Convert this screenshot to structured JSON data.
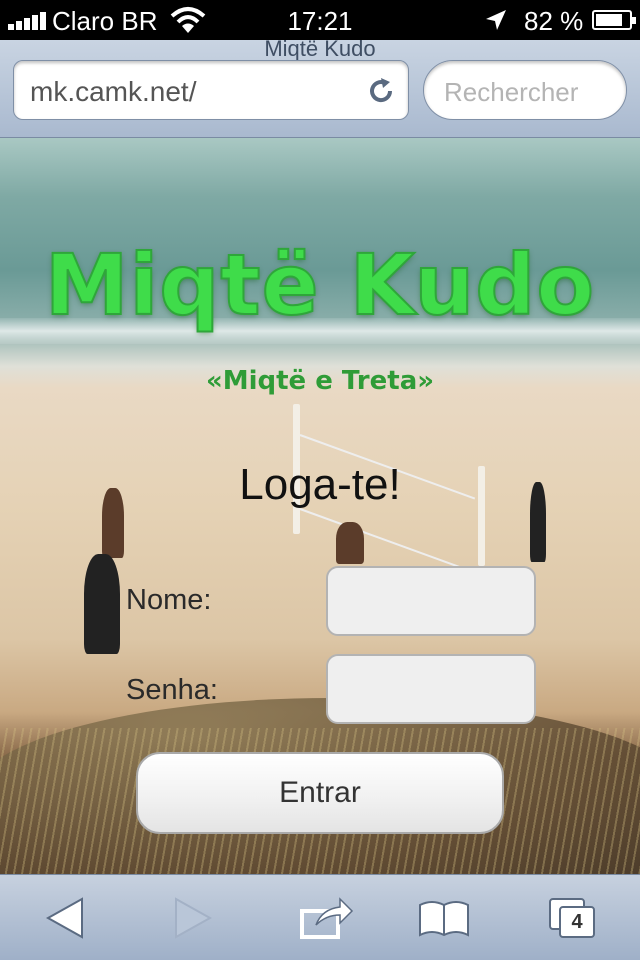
{
  "status_bar": {
    "carrier": "Claro BR",
    "time": "17:21",
    "battery_percent": "82 %",
    "battery_level": 0.82,
    "icons": [
      "signal-icon",
      "wifi-icon",
      "location-arrow-icon",
      "battery-icon"
    ]
  },
  "browser": {
    "page_title": "Miqtë Kudo",
    "url": "mk.camk.net/",
    "search_placeholder": "Rechercher",
    "tab_count": "4",
    "toolbar_icons": [
      "back-icon",
      "forward-icon",
      "share-icon",
      "bookmarks-icon",
      "tabs-icon"
    ]
  },
  "page": {
    "logo": "Miqtë Kudo",
    "tagline": "«Miqtë e Treta»",
    "login_title": "Loga-te!",
    "name_label": "Nome:",
    "password_label": "Senha:",
    "name_value": "",
    "password_value": "",
    "submit_label": "Entrar"
  },
  "colors": {
    "logo_green": "#3fdc4a",
    "tagline_green": "#2f9c37",
    "toolbar_blue": "#a9b9cf"
  }
}
